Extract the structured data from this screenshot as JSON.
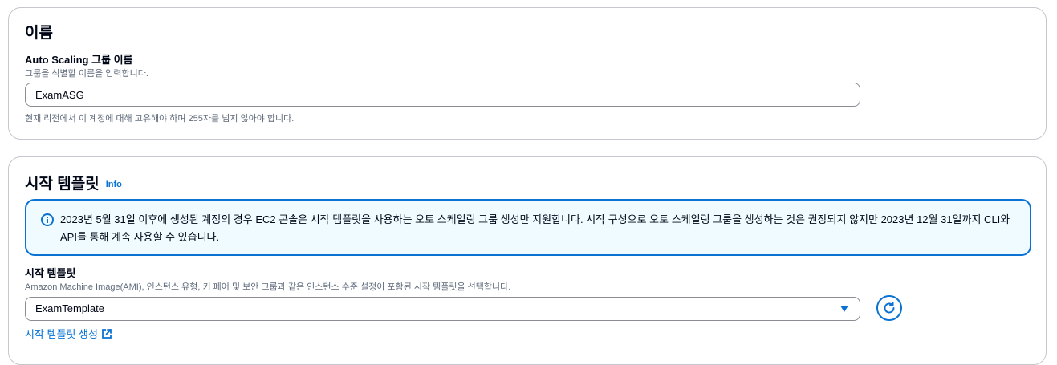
{
  "name_section": {
    "title": "이름",
    "field_label": "Auto Scaling 그룹 이름",
    "field_description": "그룹을 식별할 이름을 입력합니다.",
    "field_value": "ExamASG",
    "constraint": "현재 리전에서 이 계정에 대해 고유해야 하며 255자를 넘지 않아야 합니다."
  },
  "template_section": {
    "title": "시작 템플릿",
    "info_link": "Info",
    "alert_text": "2023년 5월 31일 이후에 생성된 계정의 경우 EC2 콘솔은 시작 템플릿을 사용하는 오토 스케일링 그룹 생성만 지원합니다. 시작 구성으로 오토 스케일링 그룹을 생성하는 것은 권장되지 않지만 2023년 12월 31일까지 CLI와 API를 통해 계속 사용할 수 있습니다.",
    "field_label": "시작 템플릿",
    "field_description": "Amazon Machine Image(AMI), 인스턴스 유형, 키 페어 및 보안 그룹과 같은 인스턴스 수준 설정이 포함된 시작 템플릿을 선택합니다.",
    "selected_value": "ExamTemplate",
    "create_link": "시작 템플릿 생성"
  },
  "colors": {
    "accent": "#0972d3",
    "alert_bg": "#f0fbff",
    "border": "#c6c6cd"
  }
}
